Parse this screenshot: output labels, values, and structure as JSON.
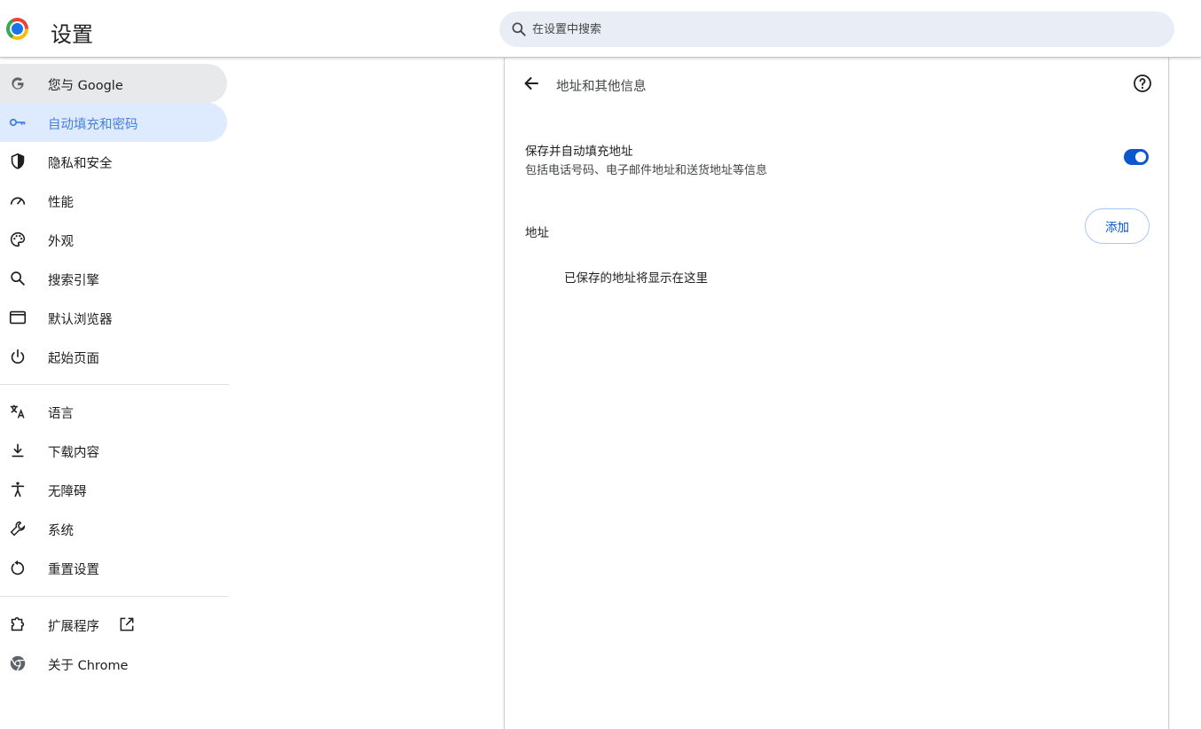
{
  "app": {
    "title": "设置"
  },
  "search": {
    "placeholder": "在设置中搜索",
    "value": ""
  },
  "sidebar": {
    "items": [
      {
        "label": "您与 Google",
        "icon": "google-icon"
      },
      {
        "label": "自动填充和密码",
        "icon": "key-icon",
        "active": true
      },
      {
        "label": "隐私和安全",
        "icon": "shield-icon"
      },
      {
        "label": "性能",
        "icon": "gauge-icon"
      },
      {
        "label": "外观",
        "icon": "palette-icon"
      },
      {
        "label": "搜索引擎",
        "icon": "search-icon"
      },
      {
        "label": "默认浏览器",
        "icon": "browser-window-icon"
      },
      {
        "label": "起始页面",
        "icon": "power-icon"
      },
      {
        "label": "语言",
        "icon": "translate-icon"
      },
      {
        "label": "下载内容",
        "icon": "download-icon"
      },
      {
        "label": "无障碍",
        "icon": "accessibility-icon"
      },
      {
        "label": "系统",
        "icon": "wrench-icon"
      },
      {
        "label": "重置设置",
        "icon": "reset-icon"
      },
      {
        "label": "扩展程序",
        "icon": "puzzle-icon"
      },
      {
        "label": "关于 Chrome",
        "icon": "chrome-icon"
      }
    ]
  },
  "page": {
    "title": "地址和其他信息",
    "setting": {
      "title": "保存并自动填充地址",
      "subtitle": "包括电话号码、电子邮件地址和送货地址等信息",
      "enabled": true
    },
    "addresses": {
      "label": "地址",
      "add_label": "添加",
      "empty_text": "已保存的地址将显示在这里"
    }
  },
  "colors": {
    "accent": "#0b57d0",
    "active_bg": "#d3e3fd",
    "search_bg": "#e9eef6"
  }
}
